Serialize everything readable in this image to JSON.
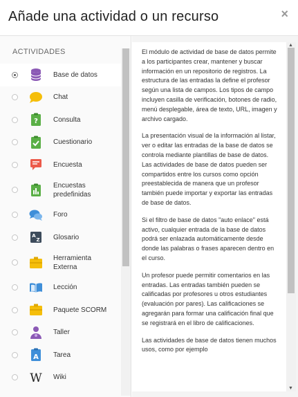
{
  "dialog": {
    "title": "Añade una actividad o un recurso",
    "close_label": "×"
  },
  "sidebar": {
    "section_title": "ACTIVIDADES",
    "items": [
      {
        "label": "Base de datos",
        "icon": "database-icon",
        "color": "#8b59b5",
        "selected": true
      },
      {
        "label": "Chat",
        "icon": "chat-icon",
        "color": "#f5be0a"
      },
      {
        "label": "Consulta",
        "icon": "choice-icon",
        "color": "#5aaf46"
      },
      {
        "label": "Cuestionario",
        "icon": "quiz-icon",
        "color": "#5aaf46"
      },
      {
        "label": "Encuesta",
        "icon": "feedback-icon",
        "color": "#ec5a4a"
      },
      {
        "label": "Encuestas predefinidas",
        "icon": "survey-icon",
        "color": "#5aaf46"
      },
      {
        "label": "Foro",
        "icon": "forum-icon",
        "color": "#3f8fd9"
      },
      {
        "label": "Glosario",
        "icon": "glossary-icon",
        "color": "#3c4b5b"
      },
      {
        "label": "Herramienta Externa",
        "icon": "external-tool-icon",
        "color": "#f5be0a"
      },
      {
        "label": "Lección",
        "icon": "lesson-icon",
        "color": "#3f8fd9"
      },
      {
        "label": "Paquete SCORM",
        "icon": "scorm-icon",
        "color": "#f5be0a"
      },
      {
        "label": "Taller",
        "icon": "workshop-icon",
        "color": "#8b59b5"
      },
      {
        "label": "Tarea",
        "icon": "assignment-icon",
        "color": "#3f8fd9"
      },
      {
        "label": "Wiki",
        "icon": "wiki-icon",
        "color": "#222222"
      }
    ]
  },
  "description": {
    "paragraphs": [
      "El módulo de actividad de base de datos permite a los participantes crear, mantener y buscar información en un repositorio de registros. La estructura de las entradas la define el profesor según una lista de campos. Los tipos de campo incluyen casilla de verificación, botones de radio, menú desplegable, área de texto, URL, imagen y archivo cargado.",
      "La presentación visual de la información al listar, ver o editar las entradas de la base de datos se controla mediante plantillas de base de datos. Las actividades de base de datos pueden ser compartidos entre los cursos como opción preestablecida de manera que un profesor también puede importar y exportar las entradas de base de datos.",
      "Si el filtro de base de datos \"auto enlace\" está activo, cualquier entrada de la base de datos podrá ser enlazada automáticamente desde donde las palabras o frases aparecen dentro en el curso.",
      "Un profesor puede permitir comentarios en las entradas. Las entradas también pueden se calificadas por profesores u otros estudiantes (evaluación por pares). Las calificaciones se agregarán para formar una calificación final que se registrará en el libro de calificaciones.",
      "Las actividades de base de datos tienen muchos usos, como por ejemplo"
    ]
  }
}
